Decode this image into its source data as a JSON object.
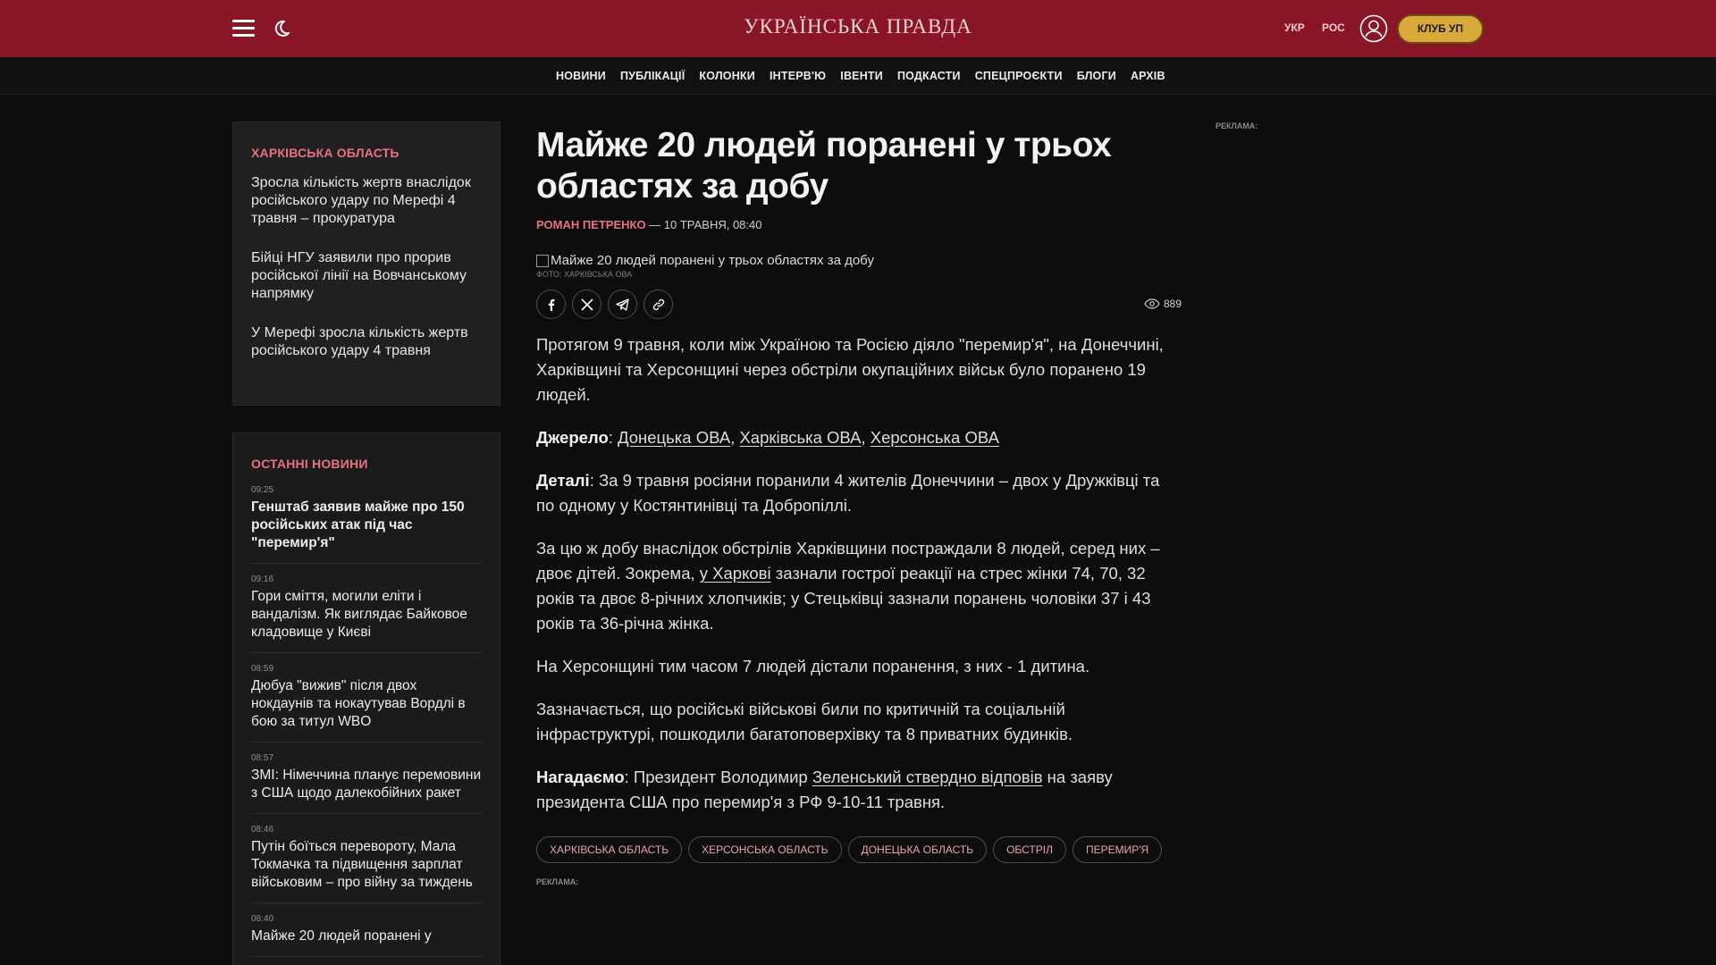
{
  "header": {
    "logo": "УКРАЇНСЬКА ПРАВДА",
    "lang_ukr": "УКР",
    "lang_ros": "РОС",
    "club_button": "КЛУБ УП"
  },
  "nav": {
    "items": [
      "НОВИНИ",
      "ПУБЛІКАЦІЇ",
      "КОЛОНКИ",
      "ІНТЕРВ'Ю",
      "ІВЕНТИ",
      "ПОДКАСТИ",
      "СПЕЦПРОЄКТИ",
      "БЛОГИ",
      "АРХІВ"
    ]
  },
  "region_box": {
    "title": "ХАРКІВСЬКА ОБЛАСТЬ",
    "items": [
      "Зросла кількість жертв внаслідок російського удару по Мерефі 4 травня – прокуратура",
      "Бійці НГУ заявили про прорив російської лінії на Вовчанському напрямку",
      "У Мерефі зросла кількість жертв російського удару 4 травня"
    ]
  },
  "latest_news": {
    "title": "ОСТАННІ НОВИНИ",
    "items": [
      {
        "time": "09:25",
        "title": "Генштаб заявив майже про 150 російських атак під час \"перемир'я\"",
        "bold": true
      },
      {
        "time": "09:16",
        "title": "Гори сміття, могили еліти і вандалізм. Як виглядає Байковое кладовище у Києві",
        "bold": false
      },
      {
        "time": "08:59",
        "title": "Дюбуа \"вижив\" після двох нокдаунів та нокаутував Вордлі в бою за титул WBO",
        "bold": false
      },
      {
        "time": "08:57",
        "title": "ЗМІ: Німеччина планує перемовини з США щодо далекобійних ракет",
        "bold": false
      },
      {
        "time": "08:46",
        "title": "Путін боїться перевороту, Мала Токмачка та підвищення зарплат військовим – про війну за тиждень",
        "bold": false
      },
      {
        "time": "08:40",
        "title": "Майже 20 людей поранені у",
        "bold": false
      }
    ]
  },
  "article": {
    "title": "Майже 20 людей поранені у трьох областях за добу",
    "author": "РОМАН ПЕТРЕНКО",
    "date": " — 10 ТРАВНЯ, 08:40",
    "photo_alt": "Майже 20 людей поранені у трьох областях за добу",
    "photo_credit": "ФОТО: ХАРКІВСЬКА ОВА",
    "views": "889",
    "p1": "Протягом 9 травня, коли між Україною та Росією діяло \"перемир'я\", на Донеччині, Харківщині та Херсонщині через обстріли окупаційних військ було поранено 19 людей.",
    "source_label": "Джерело",
    "source_sep1": ": ",
    "source_link1": "Донецька ОВА",
    "source_sep2": ", ",
    "source_link2": "Харківська ОВА",
    "source_sep3": ", ",
    "source_link3": "Херсонська ОВА",
    "details_label": "Деталі",
    "details_text": ": За 9 травня росіяни поранили 4 жителів Донеччини – двох у Дружківці та по одному у Костянтинівці та Добропіллі.",
    "p3_start": "За цю ж добу внаслідок обстрілів Харківщини постраждали 8 людей, серед них – двоє дітей. Зокрема, ",
    "p3_link": "у Харкові",
    "p3_end": " зазнали гострої реакції на стрес жінки 74, 70, 32 років та двоє 8-річних хлопчиків; у Стецьківці зазнали поранень чоловіки 37 і 43 років та 36-річна жінка.",
    "p4": "На Херсонщині тим часом 7 людей дістали поранення, з них - 1 дитина.",
    "p5": "Зазначається, що російські військові били по критичній та соціальній інфраструктурі, пошкодили багатоповерхівку та 8 приватних будинків.",
    "remind_label": "Нагадаємо",
    "remind_start": ": Президент Володимир ",
    "remind_link": "Зеленський ствердно відповів",
    "remind_end": " на заяву президента США про перемир'я з РФ 9-10-11 травня.",
    "tags": [
      "ХАРКІВСЬКА ОБЛАСТЬ",
      "ХЕРСОНСЬКА ОБЛАСТЬ",
      "ДОНЕЦЬКА ОБЛАСТЬ",
      "ОБСТРІЛ",
      "ПЕРЕМИР'Я"
    ],
    "ad_label": "РЕКЛАМА:"
  },
  "right_ad": {
    "label": "РЕКЛАМА:"
  },
  "icons": {
    "menu": "hamburger-menu-icon",
    "theme": "moon-icon",
    "user": "user-icon",
    "facebook": "facebook-icon",
    "x": "x-twitter-icon",
    "telegram": "telegram-icon",
    "link": "link-icon",
    "views": "eye-icon"
  },
  "colors": {
    "header_bg": "#8a1526",
    "accent": "#e87282",
    "club_button": "#d9a93a",
    "page_bg": "#0d0d0d"
  }
}
